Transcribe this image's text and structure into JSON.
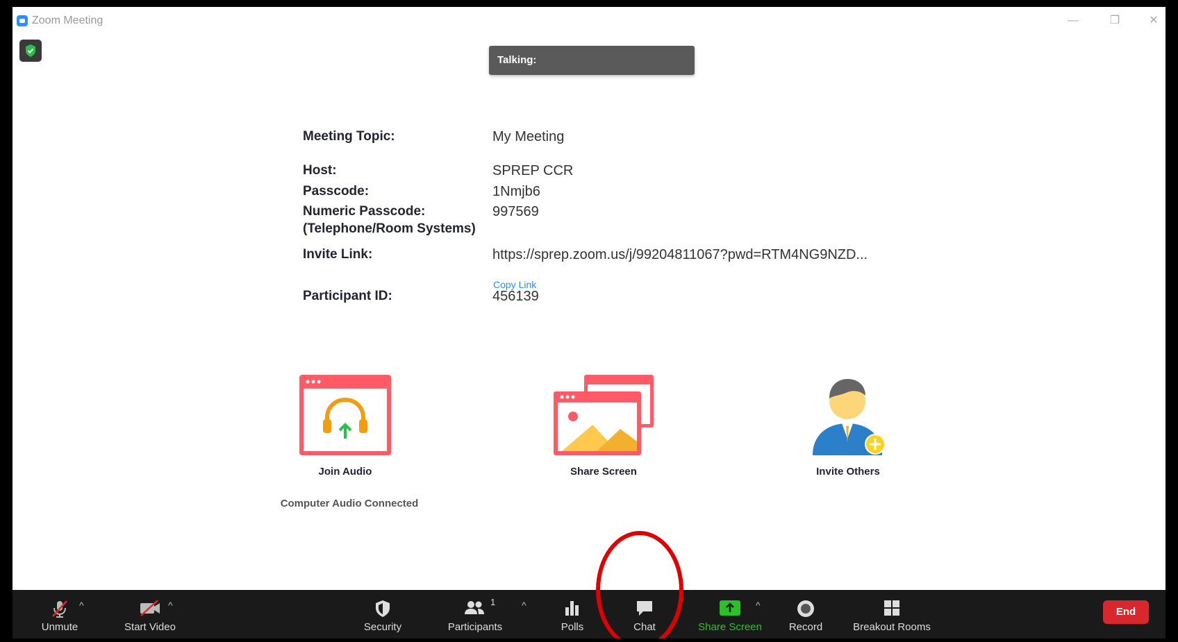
{
  "window": {
    "title": "Zoom Meeting",
    "minimize_glyph": "—",
    "restore_glyph": "❐",
    "close_glyph": "✕"
  },
  "talking": {
    "label": "Talking:"
  },
  "meeting_info": {
    "topic_label": "Meeting Topic:",
    "topic_value": "My Meeting",
    "host_label": "Host:",
    "host_value": "SPREP CCR",
    "passcode_label": "Passcode:",
    "passcode_value": "1Nmjb6",
    "numeric_passcode_label": "Numeric Passcode:",
    "numeric_passcode_sub": "(Telephone/Room Systems)",
    "numeric_passcode_value": "997569",
    "invite_link_label": "Invite Link:",
    "invite_link_value": "https://sprep.zoom.us/j/99204811067?pwd=RTM4NG9NZD...",
    "copy_link": "Copy Link",
    "participant_id_label": "Participant ID:",
    "participant_id_value": "456139"
  },
  "tiles": {
    "join_audio": "Join Audio",
    "join_audio_sub": "Computer Audio Connected",
    "share_screen": "Share Screen",
    "invite_others": "Invite Others"
  },
  "toolbar": {
    "unmute": "Unmute",
    "start_video": "Start Video",
    "security": "Security",
    "participants": "Participants",
    "participants_count": "1",
    "polls": "Polls",
    "chat": "Chat",
    "share_screen": "Share Screen",
    "record": "Record",
    "breakout_rooms": "Breakout Rooms",
    "end": "End",
    "caret": "^"
  },
  "colors": {
    "accent": "#2d8cff",
    "end_red": "#d9272e",
    "share_green": "#28c128",
    "annotation_red": "#e00000",
    "toolbar_bg": "#1a1a1a"
  }
}
